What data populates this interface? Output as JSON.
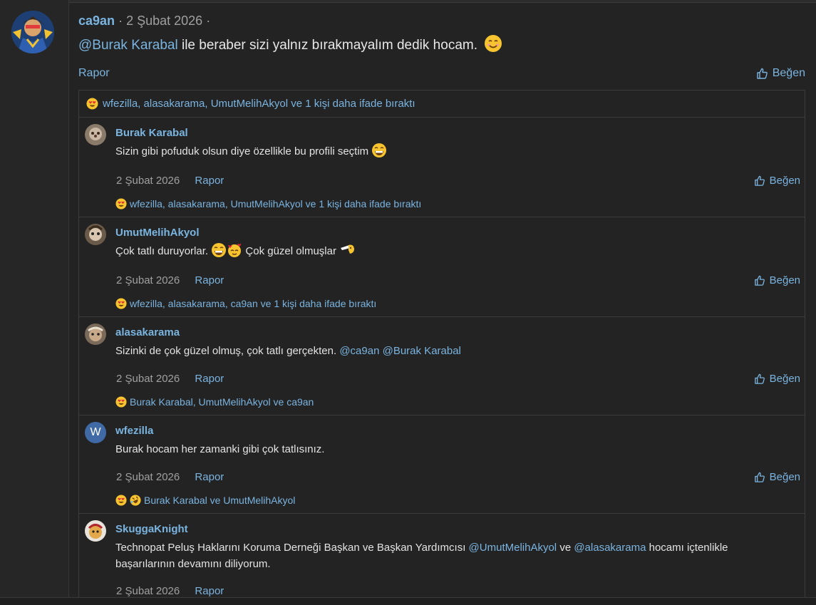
{
  "post": {
    "author": "ca9an",
    "date": "2 Şubat 2026",
    "mention": "@Burak Karabal",
    "body_rest": " ile beraber sizi yalnız bırakmayalım dedik hocam.",
    "report": "Rapor",
    "like": "Beğen",
    "reactions_summary": "wfezilla, alasakarama, UmutMelihAkyol ve 1 kişi daha ifade bıraktı"
  },
  "comments": [
    {
      "author": "Burak Karabal",
      "text": "Sizin gibi pofuduk olsun diye özellikle bu profili seçtim",
      "date": "2 Şubat 2026",
      "report": "Rapor",
      "like": "Beğen",
      "reactions": "wfezilla, alasakarama, UmutMelihAkyol ve 1 kişi daha ifade bıraktı"
    },
    {
      "author": "UmutMelihAkyol",
      "text_a": "Çok tatlı duruyorlar.",
      "text_b": "Çok güzel olmuşlar",
      "date": "2 Şubat 2026",
      "report": "Rapor",
      "like": "Beğen",
      "reactions": "wfezilla, alasakarama, ca9an ve 1 kişi daha ifade bıraktı"
    },
    {
      "author": "alasakarama",
      "text": "Sizinki de çok güzel olmuş, çok tatlı gerçekten.",
      "mention1": "@ca9an",
      "mention2": "@Burak Karabal",
      "date": "2 Şubat 2026",
      "report": "Rapor",
      "like": "Beğen",
      "reactions": "Burak Karabal, UmutMelihAkyol ve ca9an"
    },
    {
      "author": "wfezilla",
      "avatar_letter": "W",
      "text": "Burak hocam her zamanki gibi çok tatlısınız.",
      "date": "2 Şubat 2026",
      "report": "Rapor",
      "like": "Beğen",
      "reactions": "Burak Karabal ve UmutMelihAkyol"
    },
    {
      "author": "SkuggaKnight",
      "line1_a": "Technopat Peluş Haklarını Koruma Derneği Başkan ve Başkan Yardımcısı",
      "mention1": "@UmutMelihAkyol",
      "line1_b": "ve",
      "mention2": "@alasakarama",
      "line1_c": "hocamı içtenlikle",
      "line2": "başarılarının devamını diliyorum.",
      "date": "2 Şubat 2026",
      "report": "Rapor"
    }
  ],
  "colors": {
    "link": "#7ab4e0",
    "bg": "#232323",
    "border": "#3c3c3c"
  }
}
